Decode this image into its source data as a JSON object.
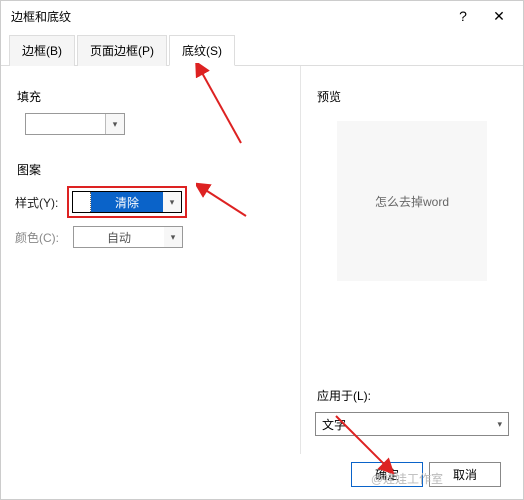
{
  "titlebar": {
    "title": "边框和底纹",
    "help": "?",
    "close": "✕"
  },
  "tabs": {
    "borders": "边框(B)",
    "pageBorders": "页面边框(P)",
    "shading": "底纹(S)"
  },
  "left": {
    "fill_label": "填充",
    "pattern_label": "图案",
    "style_label": "样式(Y):",
    "style_value": "清除",
    "color_label": "颜色(C):",
    "color_value": "自动"
  },
  "right": {
    "preview_label": "预览",
    "preview_text": "怎么去掉word",
    "applyto_label": "应用于(L):",
    "applyto_value": "文字"
  },
  "footer": {
    "ok": "确定",
    "cancel": "取消"
  },
  "watermark": "@娃娃工作室"
}
